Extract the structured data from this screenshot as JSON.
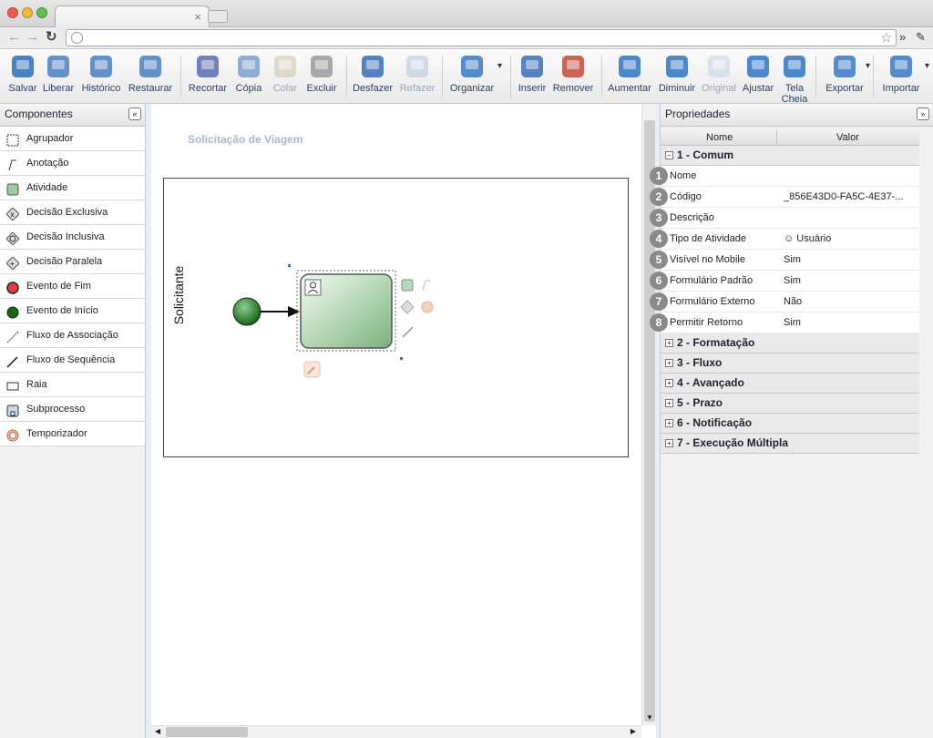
{
  "toolbar": {
    "buttons": [
      {
        "label": "Salvar",
        "icon": "save-icon"
      },
      {
        "label": "Liberar",
        "icon": "release-icon"
      },
      {
        "label": "Histórico",
        "icon": "history-icon"
      },
      {
        "label": "Restaurar",
        "icon": "restore-icon"
      },
      {
        "label": "Recortar",
        "icon": "cut-icon"
      },
      {
        "label": "Cópia",
        "icon": "copy-icon"
      },
      {
        "label": "Colar",
        "icon": "paste-icon"
      },
      {
        "label": "Excluir",
        "icon": "delete-icon"
      },
      {
        "label": "Desfazer",
        "icon": "undo-icon"
      },
      {
        "label": "Refazer",
        "icon": "redo-icon"
      },
      {
        "label": "Organizar",
        "icon": "arrange-icon"
      },
      {
        "label": "Inserir",
        "icon": "insert-point-icon"
      },
      {
        "label": "Remover",
        "icon": "remove-point-icon"
      },
      {
        "label": "Aumentar",
        "icon": "zoom-in-icon"
      },
      {
        "label": "Diminuir",
        "icon": "zoom-out-icon"
      },
      {
        "label": "Original",
        "icon": "zoom-original-icon"
      },
      {
        "label": "Ajustar",
        "icon": "zoom-fit-icon"
      },
      {
        "label": "Tela Cheia",
        "icon": "fullscreen-icon"
      },
      {
        "label": "Exportar",
        "icon": "export-icon"
      },
      {
        "label": "Importar",
        "icon": "import-icon"
      }
    ]
  },
  "components": {
    "title": "Componentes",
    "items": [
      {
        "label": "Agrupador",
        "icon": "group-icon"
      },
      {
        "label": "Anotação",
        "icon": "annotation-icon"
      },
      {
        "label": "Atividade",
        "icon": "activity-icon"
      },
      {
        "label": "Decisão Exclusiva",
        "icon": "exclusive-gateway-icon"
      },
      {
        "label": "Decisão Inclusiva",
        "icon": "inclusive-gateway-icon"
      },
      {
        "label": "Decisão Paralela",
        "icon": "parallel-gateway-icon"
      },
      {
        "label": "Evento de Fim",
        "icon": "end-event-icon"
      },
      {
        "label": "Evento de Início",
        "icon": "start-event-icon"
      },
      {
        "label": "Fluxo de Associação",
        "icon": "association-flow-icon"
      },
      {
        "label": "Fluxo de Sequência",
        "icon": "sequence-flow-icon"
      },
      {
        "label": "Raia",
        "icon": "lane-icon"
      },
      {
        "label": "Subprocesso",
        "icon": "subprocess-icon"
      },
      {
        "label": "Temporizador",
        "icon": "timer-icon"
      }
    ]
  },
  "canvas": {
    "title": "Solicitação de Viagem",
    "lane_label": "Solicitante"
  },
  "properties": {
    "title": "Propriedades",
    "col_name": "Nome",
    "col_value": "Valor",
    "group_open": "1 - Comum",
    "rows": [
      {
        "num": "1",
        "name": "Nome",
        "value": ""
      },
      {
        "num": "2",
        "name": "Código",
        "value": "_856E43D0-FA5C-4E37-..."
      },
      {
        "num": "3",
        "name": "Descrição",
        "value": ""
      },
      {
        "num": "4",
        "name": "Tipo de Atividade",
        "value": "Usuário"
      },
      {
        "num": "5",
        "name": "Visível no Mobile",
        "value": "Sim"
      },
      {
        "num": "6",
        "name": "Formulário Padrão",
        "value": "Sim"
      },
      {
        "num": "7",
        "name": "Formulário Externo",
        "value": "Não"
      },
      {
        "num": "8",
        "name": "Permitir Retorno",
        "value": "Sim"
      }
    ],
    "groups_closed": [
      "2 - Formatação",
      "3 - Fluxo",
      "4 - Avançado",
      "5 - Prazo",
      "6 - Notificação",
      "7 - Execução Múltipla"
    ]
  },
  "colors": {
    "accent": "#2c3e66",
    "activity": "#8fbf8f",
    "start": "#1e6b1e",
    "end": "#e03030"
  }
}
